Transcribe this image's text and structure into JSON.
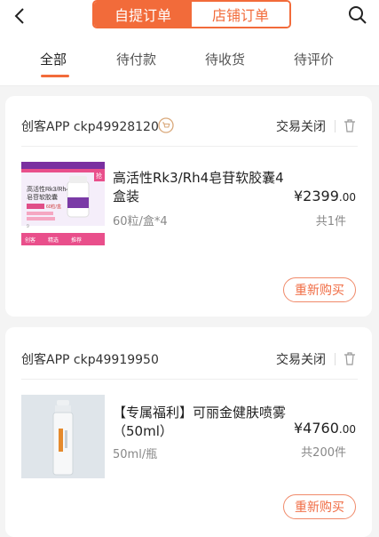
{
  "header": {
    "segments": [
      {
        "label": "自提订单",
        "active": true
      },
      {
        "label": "店铺订单",
        "active": false
      }
    ],
    "back_icon": "chevron-left",
    "search_icon": "magnifier"
  },
  "tabs": [
    {
      "label": "全部",
      "active": true
    },
    {
      "label": "待付款",
      "active": false
    },
    {
      "label": "待收货",
      "active": false
    },
    {
      "label": "待评价",
      "active": false
    }
  ],
  "orders": [
    {
      "order_id": "创客APP ckp49928120",
      "status": "交易关闭",
      "product_name": "高活性Rk3/Rh4皂苷软胶囊4盒装",
      "spec": "60粒/盒*4",
      "price_main": "¥2399",
      "price_decimal": ".00",
      "quantity": "共1件",
      "action": "重新购买",
      "thumb_text": [
        "高活性Rk3/Rh4",
        "皂苷软胶囊",
        "60粒/盒",
        "9",
        "创客",
        "精选",
        "推荐",
        "抢"
      ]
    },
    {
      "order_id": "创客APP ckp49919950",
      "status": "交易关闭",
      "product_name": "【专属福利】可丽金健肤喷雾（50ml）",
      "spec": "50ml/瓶",
      "price_main": "¥4760",
      "price_decimal": ".00",
      "quantity": "共200件",
      "action": "重新购买"
    }
  ],
  "colors": {
    "accent": "#f26b3a",
    "background": "#f4f4f4"
  }
}
